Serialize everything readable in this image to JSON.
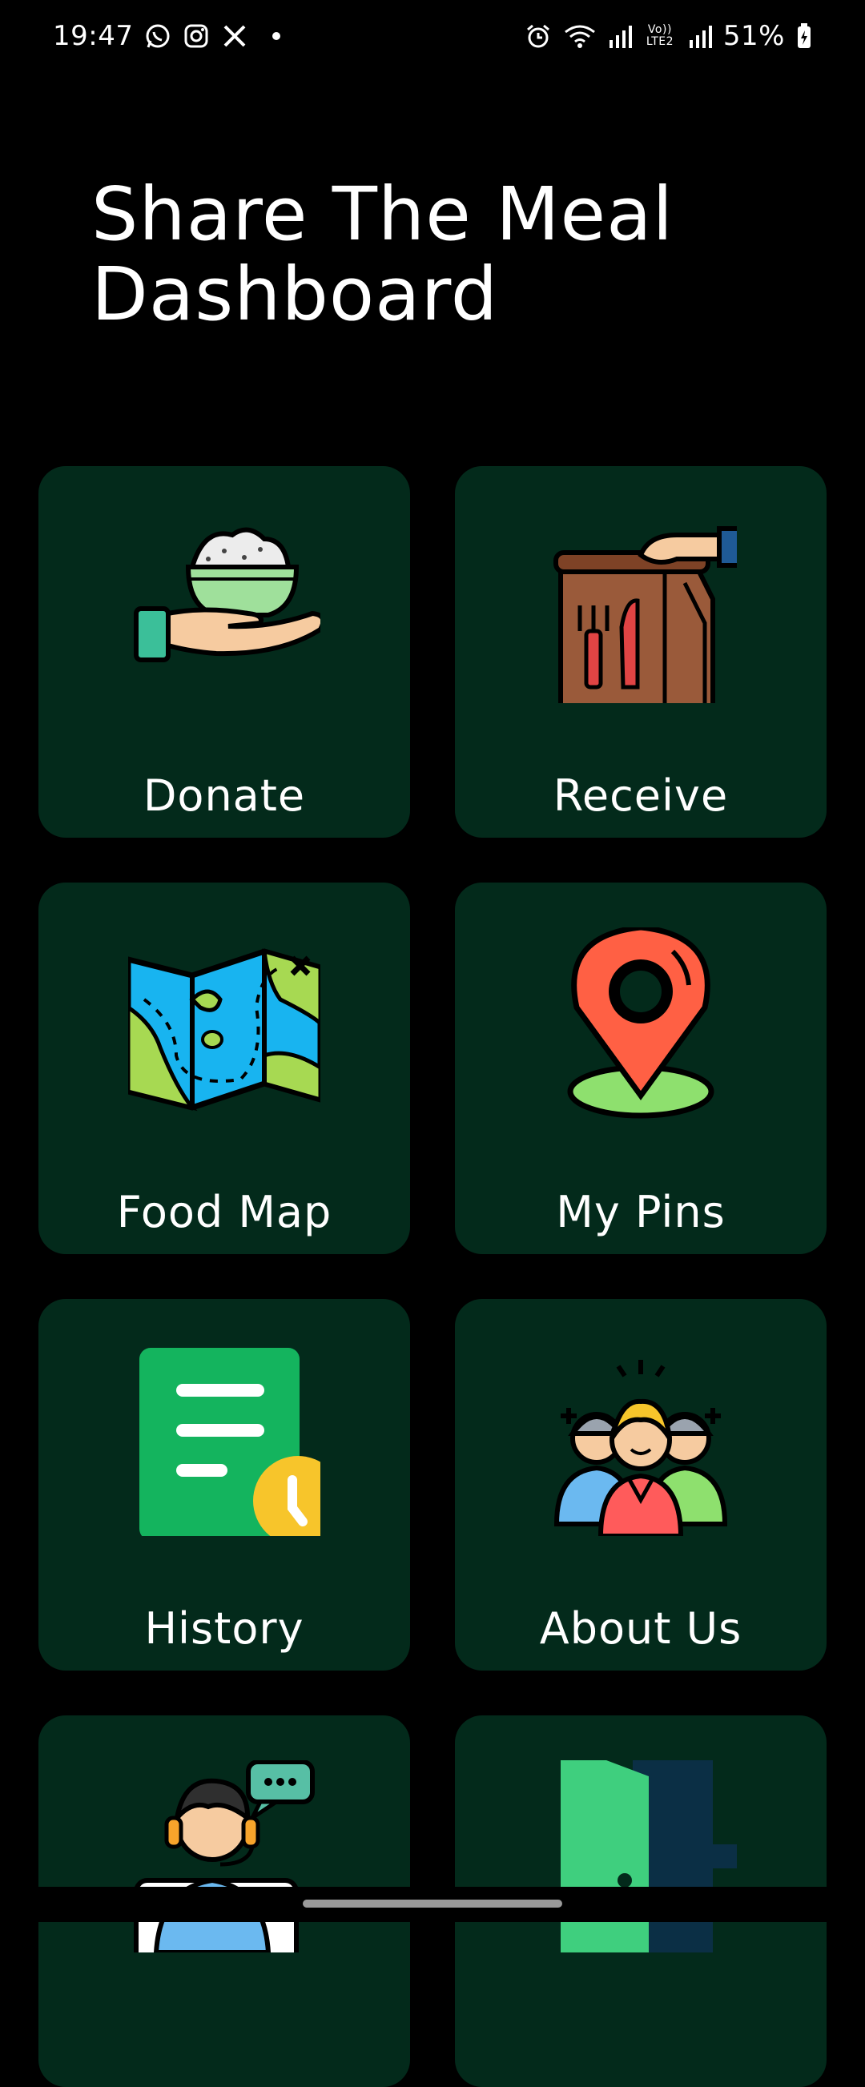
{
  "status_bar": {
    "time": "19:47",
    "left_icons": [
      "whatsapp-icon",
      "instagram-icon",
      "x-icon",
      "dot-icon"
    ],
    "right_icons": [
      "alarm-icon",
      "wifi-icon",
      "signal-icon",
      "volte-icon",
      "signal-icon-2"
    ],
    "volte_label": "Vo)) LTE2",
    "battery": "51%"
  },
  "header": {
    "title_line1": "Share The Meal",
    "title_line2": "Dashboard"
  },
  "cards": [
    {
      "label": "Donate",
      "icon": "donate-food-icon"
    },
    {
      "label": "Receive",
      "icon": "food-bag-icon"
    },
    {
      "label": "Food Map",
      "icon": "map-icon"
    },
    {
      "label": "My Pins",
      "icon": "location-pin-icon"
    },
    {
      "label": "History",
      "icon": "history-document-icon"
    },
    {
      "label": "About Us",
      "icon": "team-icon"
    },
    {
      "label": "",
      "icon": "support-agent-icon"
    },
    {
      "label": "",
      "icon": "logout-door-icon"
    }
  ],
  "colors": {
    "background": "#000000",
    "card": "#032a1b",
    "text": "#ffffff"
  }
}
